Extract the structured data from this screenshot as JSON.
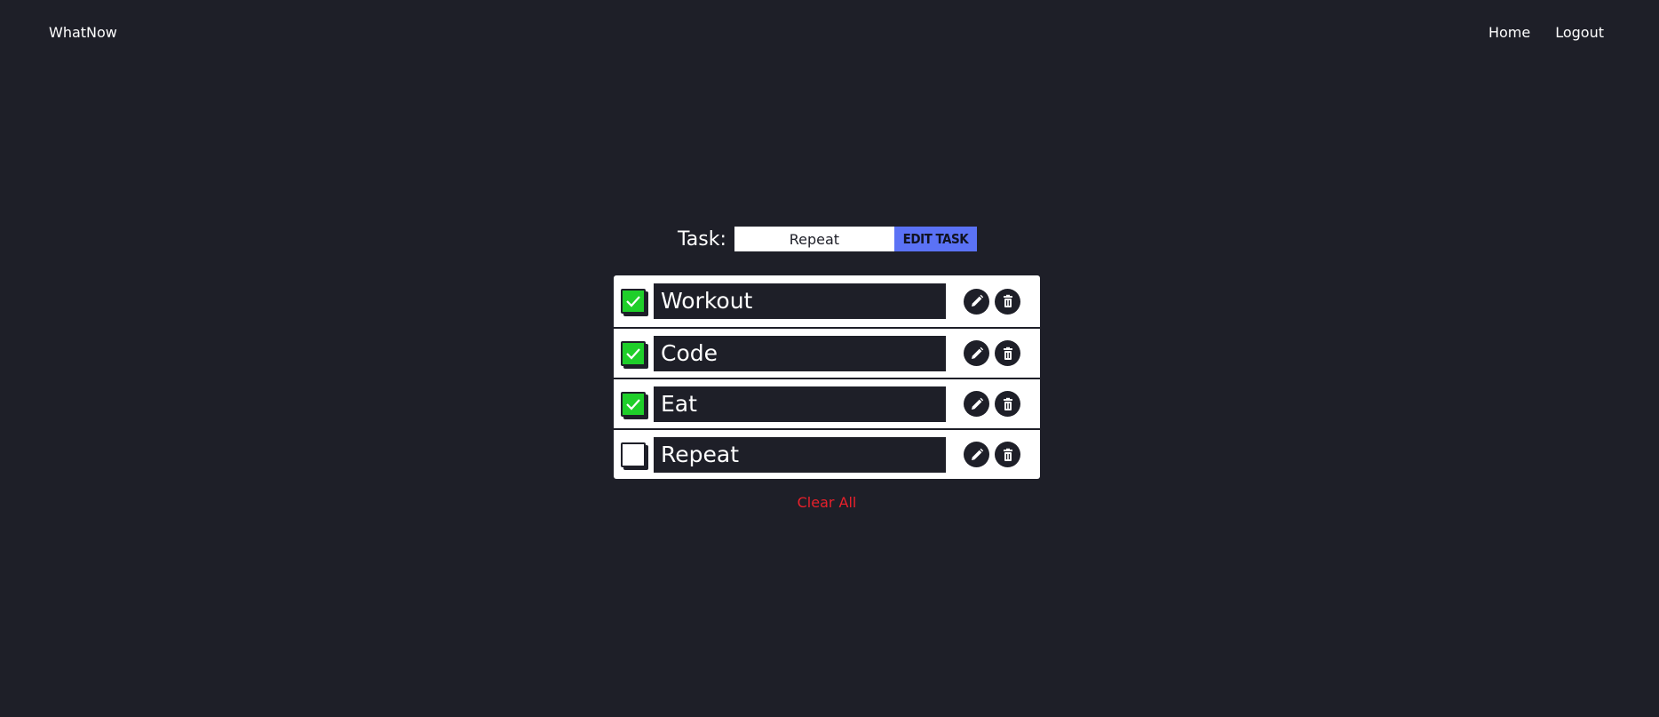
{
  "navbar": {
    "brand": "WhatNow",
    "links": [
      "Home",
      "Logout"
    ]
  },
  "task_form": {
    "label": "Task:",
    "input_value": "Repeat",
    "button_label": "EDIT TASK"
  },
  "todos": [
    {
      "text": "Workout",
      "checked": true
    },
    {
      "text": "Code",
      "checked": true
    },
    {
      "text": "Eat",
      "checked": true
    },
    {
      "text": "Repeat",
      "checked": false
    }
  ],
  "clear_all_label": "Clear All",
  "colors": {
    "background": "#1e1f28",
    "accent": "#5b72f5",
    "checked": "#1fcf2a",
    "danger": "#e8202b"
  },
  "icons": [
    "check-icon",
    "pencil-icon",
    "trash-icon"
  ]
}
